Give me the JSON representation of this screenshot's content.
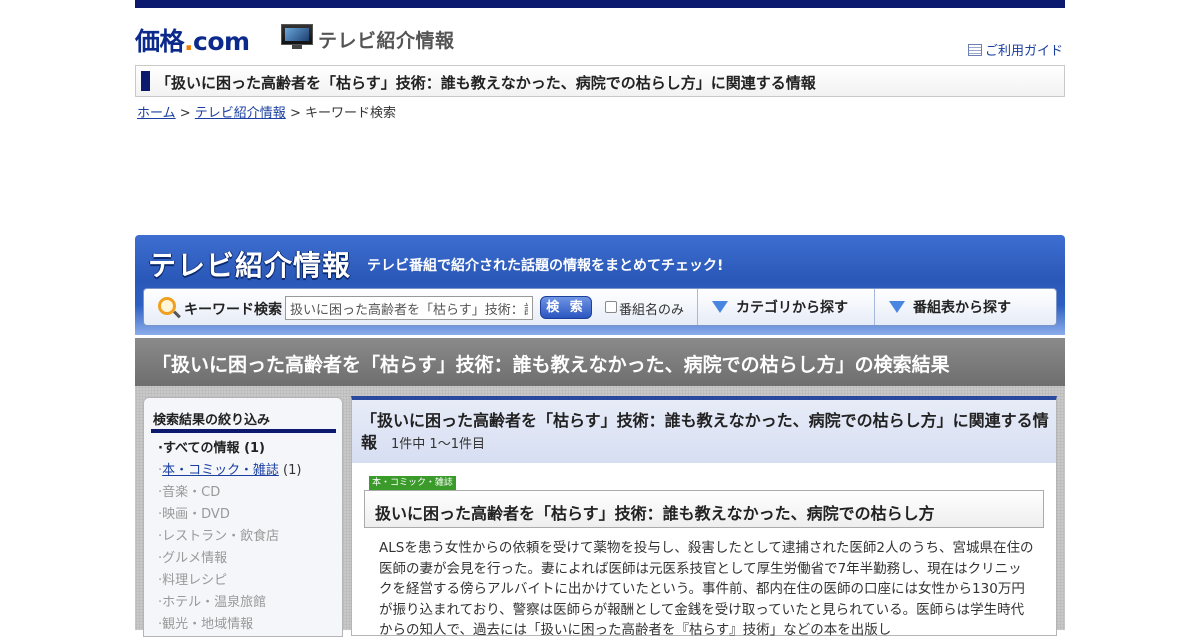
{
  "header": {
    "logo_kanji": "価格",
    "logo_dot": ".",
    "logo_com": "com",
    "site_name": "テレビ紹介情報",
    "guide_link": "ご利用ガイド"
  },
  "page_heading": "「扱いに困った高齢者を「枯らす」技術：誰も教えなかった、病院での枯らし方」に関連する情報",
  "breadcrumb": {
    "home": "ホーム",
    "sep1": " > ",
    "tv": "テレビ紹介情報",
    "sep2": " > ",
    "current": "キーワード検索"
  },
  "banner": {
    "title": "テレビ紹介情報",
    "subtitle": "テレビ番組で紹介された話題の情報をまとめてチェック!",
    "search_label": "キーワード検索",
    "search_value": "扱いに困った高齢者を「枯らす」技術：誰も教えなかった、病院での枯らし方",
    "search_button": "検 索",
    "program_only_label": "番組名のみ",
    "tab_category": "カテゴリから探す",
    "tab_schedule": "番組表から探す"
  },
  "result_title": "「扱いに困った高齢者を「枯らす」技術：誰も教えなかった、病院での枯らし方」の検索結果",
  "sidebar": {
    "title": "検索結果の絞り込み",
    "items": [
      {
        "label": "すべての情報",
        "count": "(1)"
      },
      {
        "label": "本・コミック・雑誌",
        "count": "(1)"
      },
      {
        "label": "音楽・CD"
      },
      {
        "label": "映画・DVD"
      },
      {
        "label": "レストラン・飲食店"
      },
      {
        "label": "グルメ情報"
      },
      {
        "label": "料理レシピ"
      },
      {
        "label": "ホテル・温泉旅館"
      },
      {
        "label": "観光・地域情報"
      }
    ]
  },
  "results": {
    "heading": "「扱いに困った高齢者を「枯らす」技術：誰も教えなかった、病院での枯らし方」に関連する情報",
    "count": "1件中 1～1件目",
    "item": {
      "category": "本・コミック・雑誌",
      "title": "扱いに困った高齢者を「枯らす」技術：誰も教えなかった、病院での枯らし方",
      "description": "ALSを患う女性からの依頼を受けて薬物を投与し、殺害したとして逮捕された医師2人のうち、宮城県在住の医師の妻が会見を行った。妻によれば医師は元医系技官として厚生労働省で7年半勤務し、現在はクリニックを経営する傍らアルバイトに出かけていたという。事件前、都内在住の医師の口座には女性から130万円が振り込まれており、警察は医師らが報酬として金銭を受け取っていたと見られている。医師らは学生時代からの知人で、過去には「扱いに困った高齢者を『枯らす』技術」などの本を出版し"
    }
  },
  "colors": {
    "navy": "#0b1a6e",
    "link": "#1a3fa0",
    "banner_blue": "#2a58b8",
    "category_green": "#3a9a2a"
  }
}
